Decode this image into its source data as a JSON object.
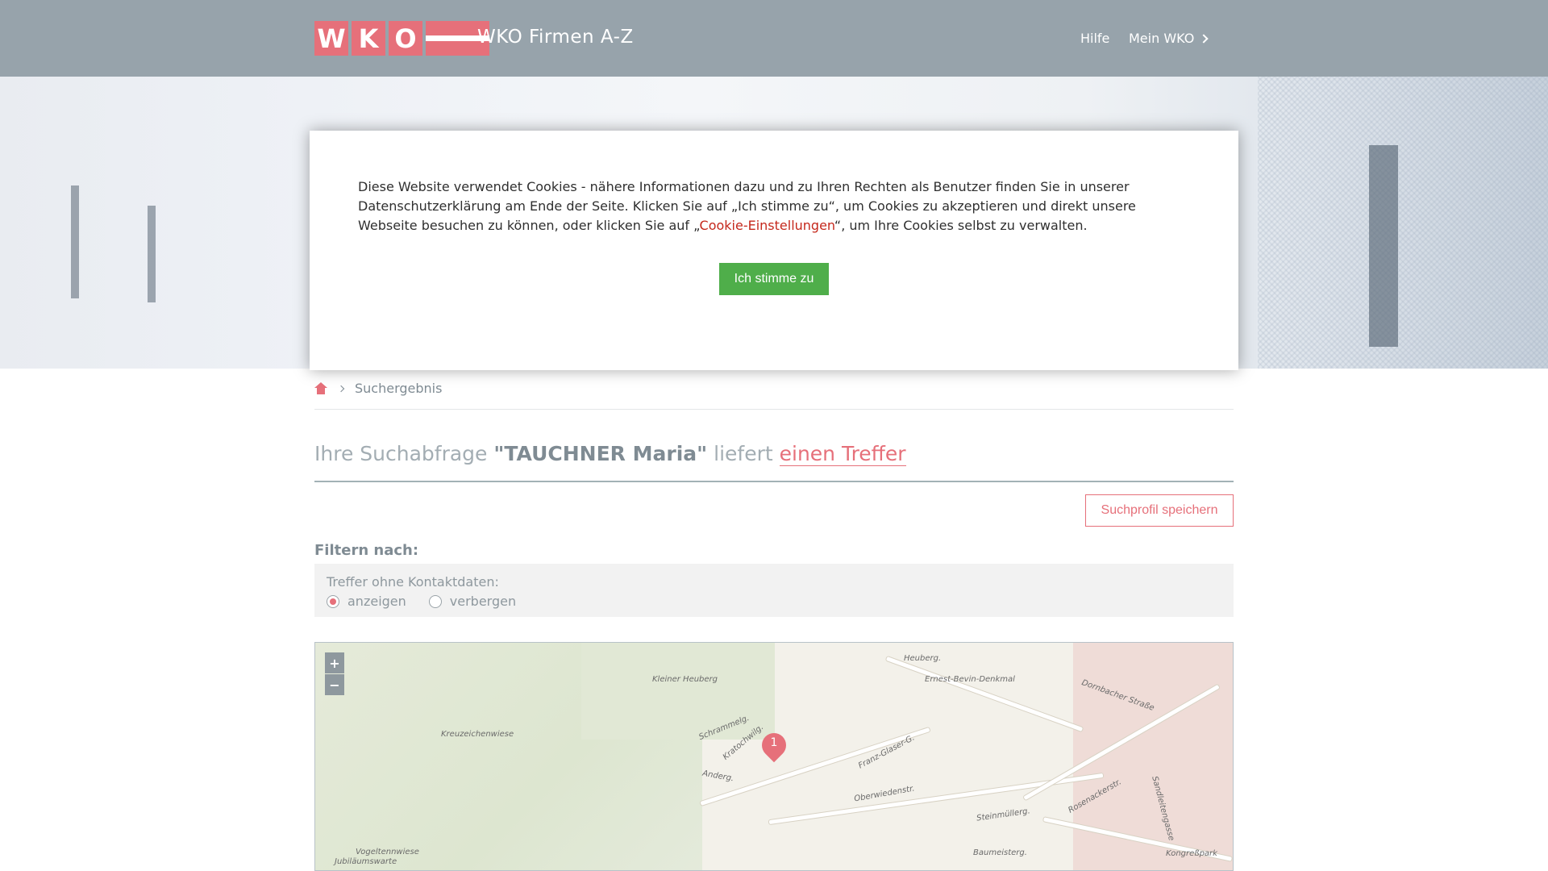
{
  "header": {
    "logo_letters": [
      "W",
      "K",
      "O"
    ],
    "site_title": "WKO Firmen A-Z",
    "nav": {
      "help": "Hilfe",
      "my_wko": "Mein WKO"
    }
  },
  "cookie": {
    "text_before": "Diese Website verwendet Cookies - nähere Informationen dazu und zu Ihren Rechten als Benutzer finden Sie in unserer Datenschutzerklärung am Ende der Seite. Klicken Sie auf „Ich stimme zu“, um Cookies zu akzeptieren und direkt unsere Webseite besuchen zu können, oder klicken Sie auf „",
    "link": "Cookie-Einstellungen",
    "text_after": "“, um Ihre Cookies selbst zu verwalten.",
    "accept": "Ich stimme zu"
  },
  "breadcrumb": {
    "current": "Suchergebnis"
  },
  "result": {
    "prefix": "Ihre Suchabfrage",
    "query": "\"TAUCHNER Maria\"",
    "middle": "liefert",
    "hits": "einen Treffer"
  },
  "save_profile": "Suchprofil speichern",
  "filter": {
    "heading": "Filtern nach:",
    "caption": "Treffer ohne Kontaktdaten:",
    "options": [
      "anzeigen",
      "verbergen"
    ],
    "selected": "anzeigen"
  },
  "map": {
    "zoom_in": "+",
    "zoom_out": "−",
    "marker": "1",
    "labels": [
      "Kreuzeichenwiese",
      "Kleiner Heuberg",
      "Heuberg.",
      "Ernest-Bevin-Denkmal",
      "Dornbacher Straße",
      "Franz-Glaser-G.",
      "Oberwiedenstr.",
      "Steinmüllerg.",
      "Baumeisterg.",
      "Vogeltennwiese",
      "Jubiläumswarte",
      "Kongreßpark",
      "Sandleitengasse",
      "Rosenackerstr.",
      "Anderg.",
      "Kratochwilg.",
      "Schrammelg."
    ]
  }
}
